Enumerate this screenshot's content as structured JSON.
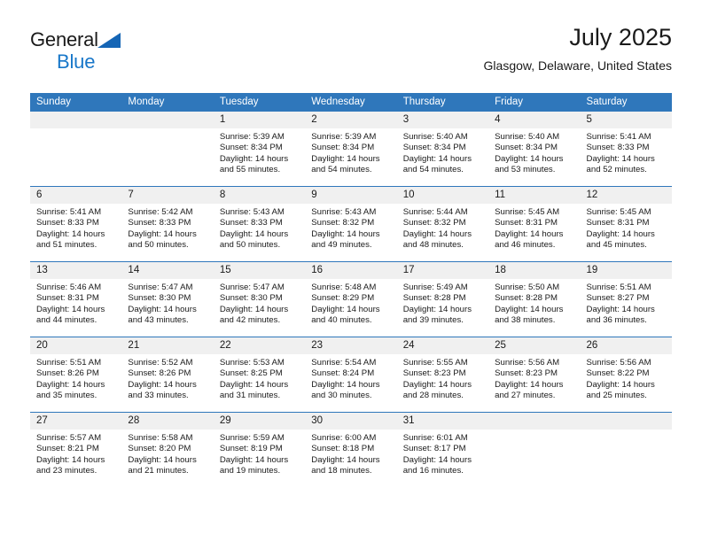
{
  "brand": {
    "name_part1": "General",
    "name_part2": "Blue",
    "triangle_color": "#1565b5",
    "blue_color": "#1877c9"
  },
  "header": {
    "title": "July 2025",
    "subtitle": "Glasgow, Delaware, United States"
  },
  "theme": {
    "header_bar_color": "#2f77bb",
    "daynum_band_color": "#f0f0f0",
    "divider_color": "#2f77bb"
  },
  "calendar": {
    "weekday_headers": [
      "Sunday",
      "Monday",
      "Tuesday",
      "Wednesday",
      "Thursday",
      "Friday",
      "Saturday"
    ],
    "weeks": [
      [
        {
          "day": "",
          "sunrise": "",
          "sunset": "",
          "daylight_line1": "",
          "daylight_line2": "",
          "blank": true
        },
        {
          "day": "",
          "sunrise": "",
          "sunset": "",
          "daylight_line1": "",
          "daylight_line2": "",
          "blank": true
        },
        {
          "day": "1",
          "sunrise": "Sunrise: 5:39 AM",
          "sunset": "Sunset: 8:34 PM",
          "daylight_line1": "Daylight: 14 hours",
          "daylight_line2": "and 55 minutes.",
          "blank": false
        },
        {
          "day": "2",
          "sunrise": "Sunrise: 5:39 AM",
          "sunset": "Sunset: 8:34 PM",
          "daylight_line1": "Daylight: 14 hours",
          "daylight_line2": "and 54 minutes.",
          "blank": false
        },
        {
          "day": "3",
          "sunrise": "Sunrise: 5:40 AM",
          "sunset": "Sunset: 8:34 PM",
          "daylight_line1": "Daylight: 14 hours",
          "daylight_line2": "and 54 minutes.",
          "blank": false
        },
        {
          "day": "4",
          "sunrise": "Sunrise: 5:40 AM",
          "sunset": "Sunset: 8:34 PM",
          "daylight_line1": "Daylight: 14 hours",
          "daylight_line2": "and 53 minutes.",
          "blank": false
        },
        {
          "day": "5",
          "sunrise": "Sunrise: 5:41 AM",
          "sunset": "Sunset: 8:33 PM",
          "daylight_line1": "Daylight: 14 hours",
          "daylight_line2": "and 52 minutes.",
          "blank": false
        }
      ],
      [
        {
          "day": "6",
          "sunrise": "Sunrise: 5:41 AM",
          "sunset": "Sunset: 8:33 PM",
          "daylight_line1": "Daylight: 14 hours",
          "daylight_line2": "and 51 minutes.",
          "blank": false
        },
        {
          "day": "7",
          "sunrise": "Sunrise: 5:42 AM",
          "sunset": "Sunset: 8:33 PM",
          "daylight_line1": "Daylight: 14 hours",
          "daylight_line2": "and 50 minutes.",
          "blank": false
        },
        {
          "day": "8",
          "sunrise": "Sunrise: 5:43 AM",
          "sunset": "Sunset: 8:33 PM",
          "daylight_line1": "Daylight: 14 hours",
          "daylight_line2": "and 50 minutes.",
          "blank": false
        },
        {
          "day": "9",
          "sunrise": "Sunrise: 5:43 AM",
          "sunset": "Sunset: 8:32 PM",
          "daylight_line1": "Daylight: 14 hours",
          "daylight_line2": "and 49 minutes.",
          "blank": false
        },
        {
          "day": "10",
          "sunrise": "Sunrise: 5:44 AM",
          "sunset": "Sunset: 8:32 PM",
          "daylight_line1": "Daylight: 14 hours",
          "daylight_line2": "and 48 minutes.",
          "blank": false
        },
        {
          "day": "11",
          "sunrise": "Sunrise: 5:45 AM",
          "sunset": "Sunset: 8:31 PM",
          "daylight_line1": "Daylight: 14 hours",
          "daylight_line2": "and 46 minutes.",
          "blank": false
        },
        {
          "day": "12",
          "sunrise": "Sunrise: 5:45 AM",
          "sunset": "Sunset: 8:31 PM",
          "daylight_line1": "Daylight: 14 hours",
          "daylight_line2": "and 45 minutes.",
          "blank": false
        }
      ],
      [
        {
          "day": "13",
          "sunrise": "Sunrise: 5:46 AM",
          "sunset": "Sunset: 8:31 PM",
          "daylight_line1": "Daylight: 14 hours",
          "daylight_line2": "and 44 minutes.",
          "blank": false
        },
        {
          "day": "14",
          "sunrise": "Sunrise: 5:47 AM",
          "sunset": "Sunset: 8:30 PM",
          "daylight_line1": "Daylight: 14 hours",
          "daylight_line2": "and 43 minutes.",
          "blank": false
        },
        {
          "day": "15",
          "sunrise": "Sunrise: 5:47 AM",
          "sunset": "Sunset: 8:30 PM",
          "daylight_line1": "Daylight: 14 hours",
          "daylight_line2": "and 42 minutes.",
          "blank": false
        },
        {
          "day": "16",
          "sunrise": "Sunrise: 5:48 AM",
          "sunset": "Sunset: 8:29 PM",
          "daylight_line1": "Daylight: 14 hours",
          "daylight_line2": "and 40 minutes.",
          "blank": false
        },
        {
          "day": "17",
          "sunrise": "Sunrise: 5:49 AM",
          "sunset": "Sunset: 8:28 PM",
          "daylight_line1": "Daylight: 14 hours",
          "daylight_line2": "and 39 minutes.",
          "blank": false
        },
        {
          "day": "18",
          "sunrise": "Sunrise: 5:50 AM",
          "sunset": "Sunset: 8:28 PM",
          "daylight_line1": "Daylight: 14 hours",
          "daylight_line2": "and 38 minutes.",
          "blank": false
        },
        {
          "day": "19",
          "sunrise": "Sunrise: 5:51 AM",
          "sunset": "Sunset: 8:27 PM",
          "daylight_line1": "Daylight: 14 hours",
          "daylight_line2": "and 36 minutes.",
          "blank": false
        }
      ],
      [
        {
          "day": "20",
          "sunrise": "Sunrise: 5:51 AM",
          "sunset": "Sunset: 8:26 PM",
          "daylight_line1": "Daylight: 14 hours",
          "daylight_line2": "and 35 minutes.",
          "blank": false
        },
        {
          "day": "21",
          "sunrise": "Sunrise: 5:52 AM",
          "sunset": "Sunset: 8:26 PM",
          "daylight_line1": "Daylight: 14 hours",
          "daylight_line2": "and 33 minutes.",
          "blank": false
        },
        {
          "day": "22",
          "sunrise": "Sunrise: 5:53 AM",
          "sunset": "Sunset: 8:25 PM",
          "daylight_line1": "Daylight: 14 hours",
          "daylight_line2": "and 31 minutes.",
          "blank": false
        },
        {
          "day": "23",
          "sunrise": "Sunrise: 5:54 AM",
          "sunset": "Sunset: 8:24 PM",
          "daylight_line1": "Daylight: 14 hours",
          "daylight_line2": "and 30 minutes.",
          "blank": false
        },
        {
          "day": "24",
          "sunrise": "Sunrise: 5:55 AM",
          "sunset": "Sunset: 8:23 PM",
          "daylight_line1": "Daylight: 14 hours",
          "daylight_line2": "and 28 minutes.",
          "blank": false
        },
        {
          "day": "25",
          "sunrise": "Sunrise: 5:56 AM",
          "sunset": "Sunset: 8:23 PM",
          "daylight_line1": "Daylight: 14 hours",
          "daylight_line2": "and 27 minutes.",
          "blank": false
        },
        {
          "day": "26",
          "sunrise": "Sunrise: 5:56 AM",
          "sunset": "Sunset: 8:22 PM",
          "daylight_line1": "Daylight: 14 hours",
          "daylight_line2": "and 25 minutes.",
          "blank": false
        }
      ],
      [
        {
          "day": "27",
          "sunrise": "Sunrise: 5:57 AM",
          "sunset": "Sunset: 8:21 PM",
          "daylight_line1": "Daylight: 14 hours",
          "daylight_line2": "and 23 minutes.",
          "blank": false
        },
        {
          "day": "28",
          "sunrise": "Sunrise: 5:58 AM",
          "sunset": "Sunset: 8:20 PM",
          "daylight_line1": "Daylight: 14 hours",
          "daylight_line2": "and 21 minutes.",
          "blank": false
        },
        {
          "day": "29",
          "sunrise": "Sunrise: 5:59 AM",
          "sunset": "Sunset: 8:19 PM",
          "daylight_line1": "Daylight: 14 hours",
          "daylight_line2": "and 19 minutes.",
          "blank": false
        },
        {
          "day": "30",
          "sunrise": "Sunrise: 6:00 AM",
          "sunset": "Sunset: 8:18 PM",
          "daylight_line1": "Daylight: 14 hours",
          "daylight_line2": "and 18 minutes.",
          "blank": false
        },
        {
          "day": "31",
          "sunrise": "Sunrise: 6:01 AM",
          "sunset": "Sunset: 8:17 PM",
          "daylight_line1": "Daylight: 14 hours",
          "daylight_line2": "and 16 minutes.",
          "blank": false
        },
        {
          "day": "",
          "sunrise": "",
          "sunset": "",
          "daylight_line1": "",
          "daylight_line2": "",
          "blank": true
        },
        {
          "day": "",
          "sunrise": "",
          "sunset": "",
          "daylight_line1": "",
          "daylight_line2": "",
          "blank": true
        }
      ]
    ]
  }
}
